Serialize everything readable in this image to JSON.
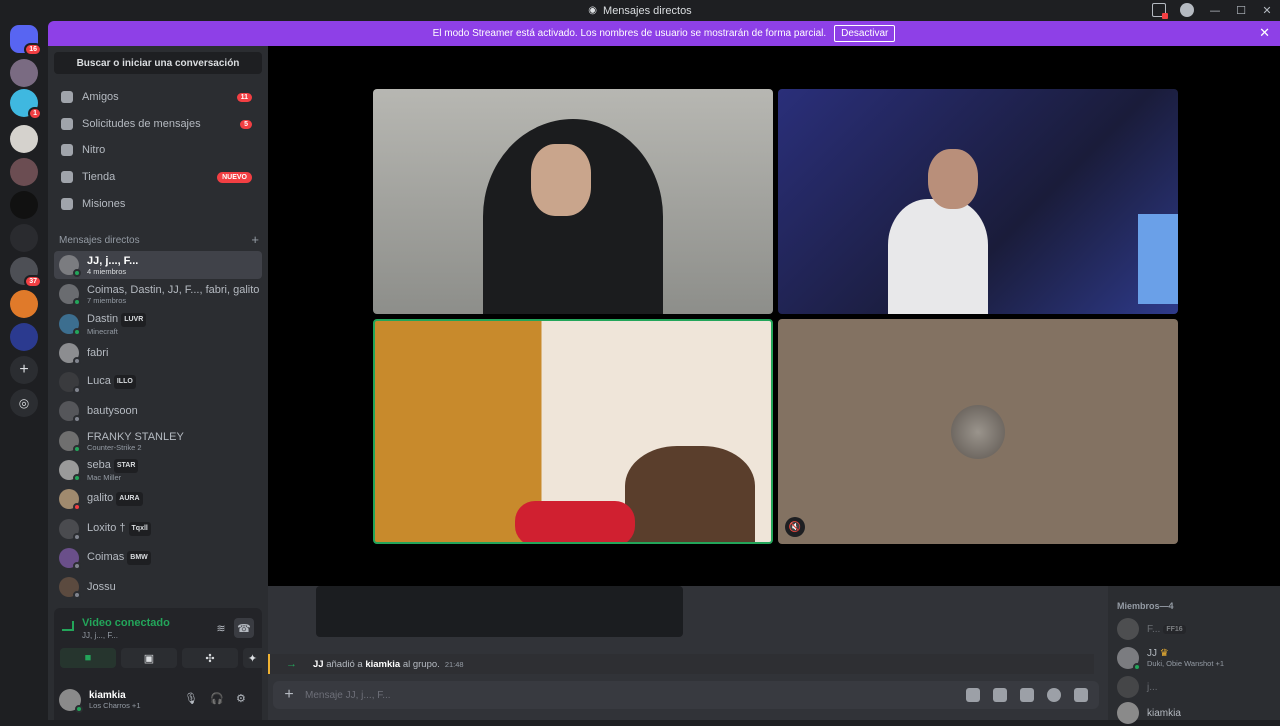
{
  "window": {
    "title": "Mensajes directos"
  },
  "banner": {
    "text": "El modo Streamer está activado. Los nombres de usuario se mostrarán de forma parcial.",
    "button": "Desactivar"
  },
  "guilds": [
    {
      "badge": "16"
    },
    {
      "badge": ""
    },
    {
      "badge": "1"
    },
    {
      "badge": ""
    },
    {
      "badge": ""
    },
    {
      "badge": ""
    },
    {
      "badge": ""
    },
    {
      "badge": "37"
    },
    {
      "badge": ""
    },
    {
      "badge": ""
    }
  ],
  "sidebar": {
    "search": "Buscar o iniciar una conversación",
    "nav": [
      {
        "label": "Amigos",
        "count": "11"
      },
      {
        "label": "Solicitudes de mensajes",
        "count": "5"
      },
      {
        "label": "Nitro",
        "count": ""
      },
      {
        "label": "Tienda",
        "count": "NUEVO"
      },
      {
        "label": "Misiones",
        "count": ""
      }
    ],
    "dm_header": "Mensajes directos",
    "dm_add": "+",
    "dms": [
      {
        "name": "JJ, j..., F...",
        "sub": "4 miembros",
        "tag": ""
      },
      {
        "name": "Coimas, Dastin, JJ, F..., fabri, galito",
        "sub": "7 miembros",
        "tag": ""
      },
      {
        "name": "Dastin",
        "sub": "Minecraft",
        "tag": "LUVR"
      },
      {
        "name": "fabri",
        "sub": "",
        "tag": ""
      },
      {
        "name": "Luca",
        "sub": "",
        "tag": "ILLO"
      },
      {
        "name": "bautysoon",
        "sub": "",
        "tag": ""
      },
      {
        "name": "FRANKY STANLEY",
        "sub": "Counter-Strike 2",
        "tag": ""
      },
      {
        "name": "seba",
        "sub": "Mac Miller",
        "tag": "STAR"
      },
      {
        "name": "galito",
        "sub": "",
        "tag": "AURA"
      },
      {
        "name": "Loxito †",
        "sub": "",
        "tag": "Tqxll"
      },
      {
        "name": "Coimas",
        "sub": "",
        "tag": "BMW"
      },
      {
        "name": "Jossu",
        "sub": "",
        "tag": ""
      }
    ]
  },
  "voice": {
    "title": "Video conectado",
    "subtitle": "JJ, j..., F..."
  },
  "user": {
    "name": "kiamkia",
    "status": "Los Charros +1"
  },
  "chat": {
    "system": {
      "actor": "JJ",
      "action": "añadió a",
      "target": "kiamkia",
      "suffix": "al grupo.",
      "time": "21:48"
    },
    "composer_placeholder": "Mensaje JJ, j..., F..."
  },
  "members": {
    "header": "Miembros—4",
    "list": [
      {
        "name": "F...",
        "sub": "",
        "tag": "FF16"
      },
      {
        "name": "JJ",
        "sub": "Duki, Obie Wanshot +1"
      },
      {
        "name": "j...",
        "sub": ""
      },
      {
        "name": "kiamkia",
        "sub": ""
      }
    ]
  },
  "colors": {
    "accent": "#8e40e7",
    "online": "#23a55a",
    "danger": "#f23f43"
  }
}
